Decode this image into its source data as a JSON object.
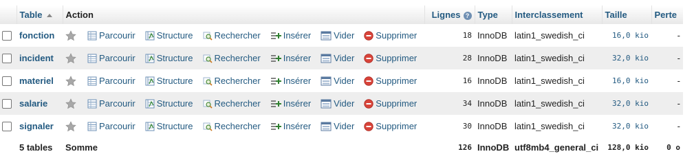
{
  "header": {
    "table": "Table",
    "action": "Action",
    "rows": "Lignes",
    "type": "Type",
    "collation": "Interclassement",
    "size": "Taille",
    "overhead": "Perte"
  },
  "actions": {
    "browse": "Parcourir",
    "structure": "Structure",
    "search": "Rechercher",
    "insert": "Insérer",
    "empty": "Vider",
    "drop": "Supprimer"
  },
  "rows": [
    {
      "name": "fonction",
      "rows": "18",
      "type": "InnoDB",
      "collation": "latin1_swedish_ci",
      "size": "16,0 kio",
      "overhead": "-"
    },
    {
      "name": "incident",
      "rows": "28",
      "type": "InnoDB",
      "collation": "latin1_swedish_ci",
      "size": "32,0 kio",
      "overhead": "-"
    },
    {
      "name": "materiel",
      "rows": "16",
      "type": "InnoDB",
      "collation": "latin1_swedish_ci",
      "size": "16,0 kio",
      "overhead": "-"
    },
    {
      "name": "salarie",
      "rows": "34",
      "type": "InnoDB",
      "collation": "latin1_swedish_ci",
      "size": "32,0 kio",
      "overhead": "-"
    },
    {
      "name": "signaler",
      "rows": "30",
      "type": "InnoDB",
      "collation": "latin1_swedish_ci",
      "size": "32,0 kio",
      "overhead": "-"
    }
  ],
  "footer": {
    "tables": "5 tables",
    "sum": "Somme",
    "rows": "126",
    "type": "InnoDB",
    "collation": "utf8mb4_general_ci",
    "size": "128,0 kio",
    "overhead": "0 o"
  },
  "colors": {
    "link": "#235a81",
    "row_alt": "#eeeeee",
    "drop_icon": "#d9443a"
  },
  "icons": [
    "star-icon",
    "browse-icon",
    "structure-icon",
    "search-icon",
    "insert-icon",
    "empty-icon",
    "drop-icon",
    "help-icon",
    "sort-asc-icon"
  ]
}
